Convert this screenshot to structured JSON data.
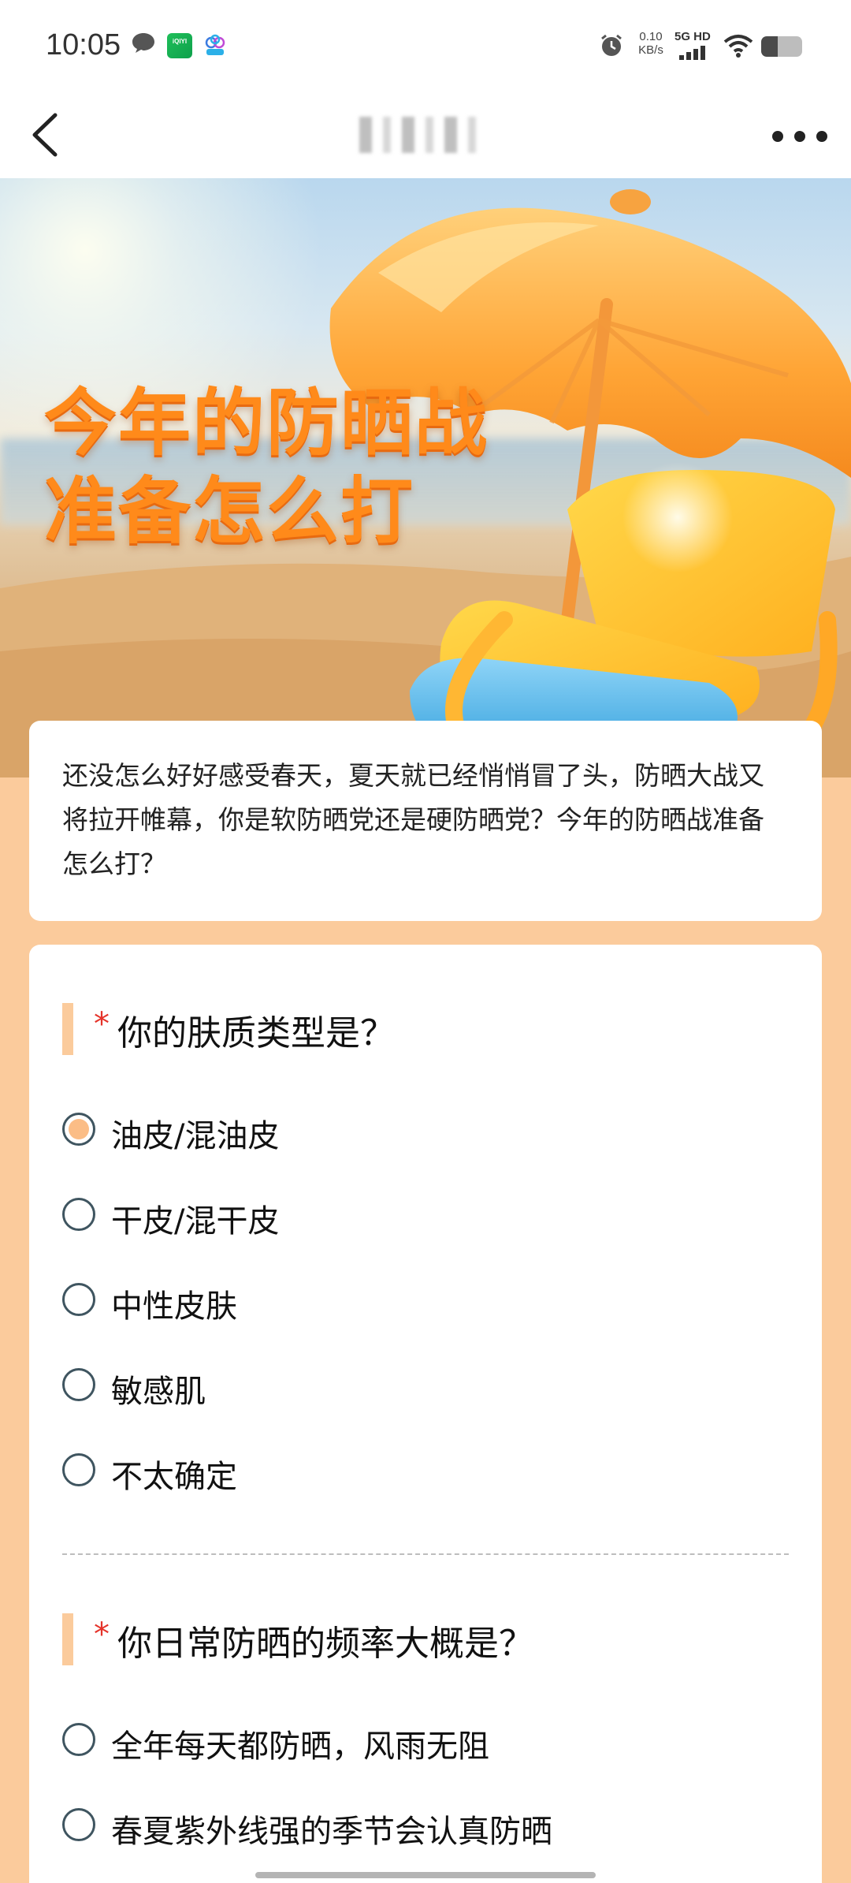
{
  "status_bar": {
    "time": "10:05",
    "net_speed_value": "0.10",
    "net_speed_unit": "KB/s",
    "signal_label": "5G HD",
    "battery_level": 0.4,
    "icons": [
      "chat-bubble-icon",
      "iqiyi-app-icon",
      "cloud-app-icon",
      "alarm-icon",
      "signal-icon",
      "wifi-icon",
      "battery-icon"
    ],
    "iqiyi_label": "iQIYI"
  },
  "nav": {
    "back_icon": "chevron-left-icon",
    "more_icon": "more-dots-icon"
  },
  "banner": {
    "title_line1": "今年的防晒战",
    "title_line2": "准备怎么打"
  },
  "intro": {
    "text": "还没怎么好好感受春天，夏天就已经悄悄冒了头，防晒大战又将拉开帷幕，你是软防晒党还是硬防晒党？今年的防晒战准备怎么打？"
  },
  "questions": [
    {
      "required_mark": "*",
      "title": "你的肤质类型是？",
      "options": [
        {
          "label": "油皮/混油皮",
          "selected": true
        },
        {
          "label": "干皮/混干皮",
          "selected": false
        },
        {
          "label": "中性皮肤",
          "selected": false
        },
        {
          "label": "敏感肌",
          "selected": false
        },
        {
          "label": "不太确定",
          "selected": false
        }
      ]
    },
    {
      "required_mark": "*",
      "title": "你日常防晒的频率大概是？",
      "options": [
        {
          "label": "全年每天都防晒，风雨无阻",
          "selected": false
        },
        {
          "label": "春夏紫外线强的季节会认真防晒",
          "selected": false
        }
      ]
    }
  ],
  "colors": {
    "page_background": "#fbcb9c",
    "accent_peach": "#fbbd86",
    "required_red": "#e5332a",
    "title_orange": "#ff8a1a"
  }
}
